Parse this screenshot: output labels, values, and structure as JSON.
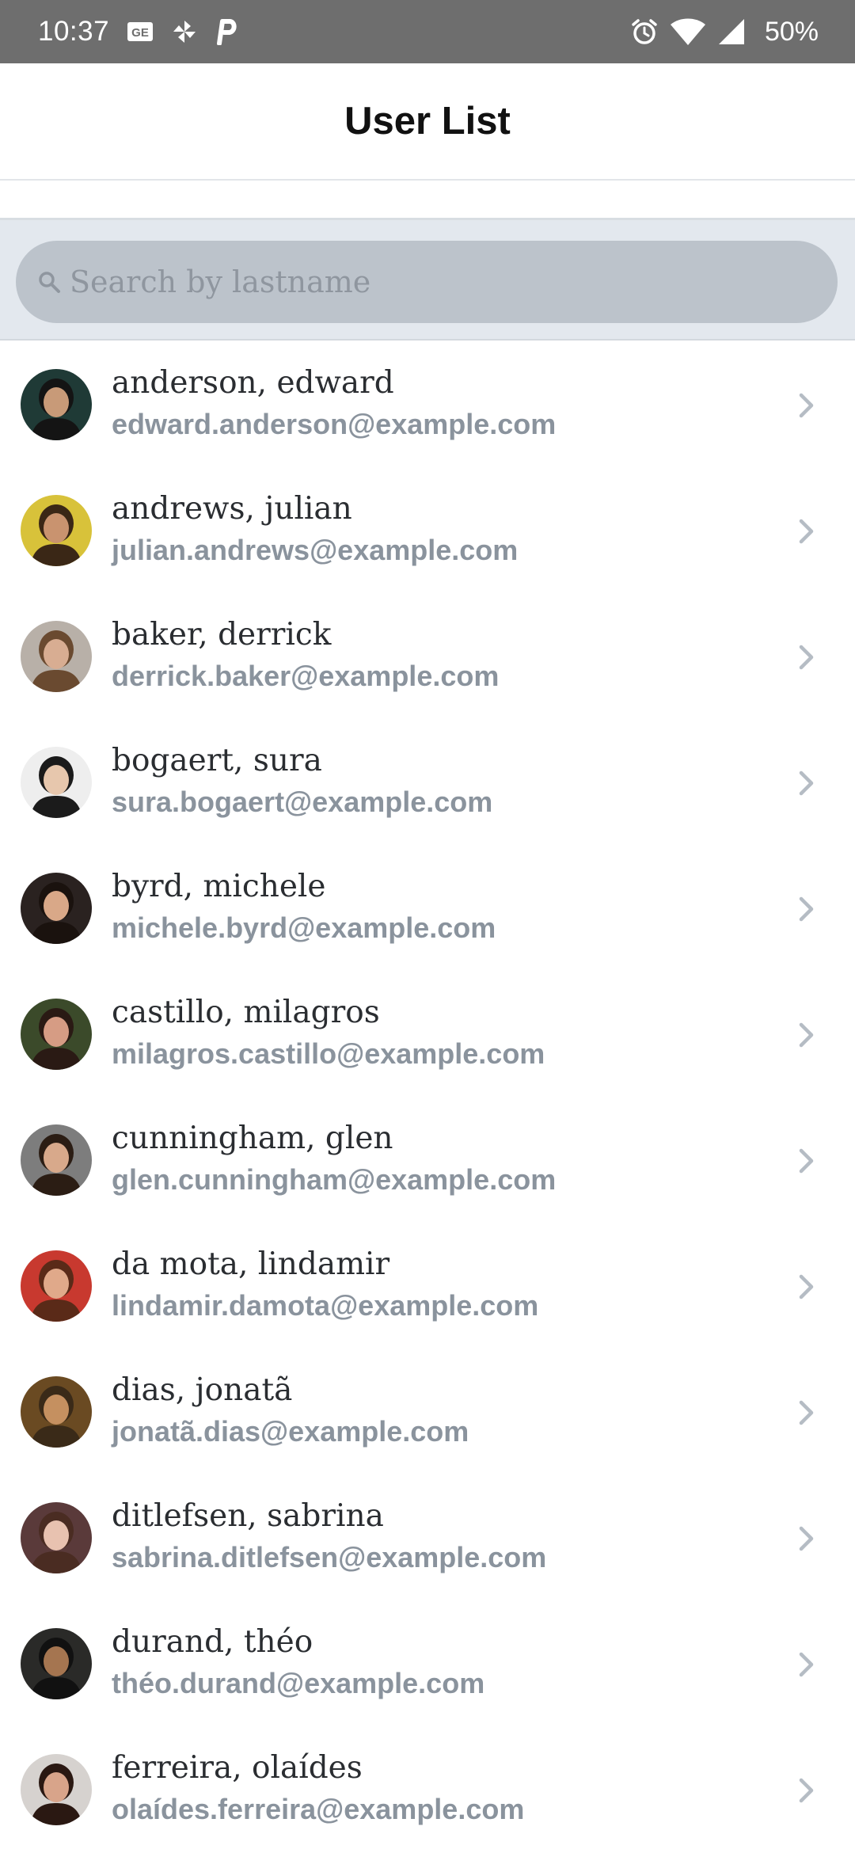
{
  "status_bar": {
    "time": "10:37",
    "battery": "50%",
    "left_icons": [
      "gmail-icon",
      "pinwheel-icon",
      "parking-icon"
    ],
    "right_icons": [
      "alarm-icon",
      "wifi-icon",
      "cell-signal-icon"
    ]
  },
  "header": {
    "title": "User List"
  },
  "search": {
    "placeholder": "Search by lastname",
    "value": ""
  },
  "users": [
    {
      "name": "anderson, edward",
      "email": "edward.anderson@example.com",
      "avatar_bg": "#1f3a36",
      "avatar_skin": "#c89a78",
      "avatar_hair": "#141414"
    },
    {
      "name": "andrews, julian",
      "email": "julian.andrews@example.com",
      "avatar_bg": "#d8c23a",
      "avatar_skin": "#c9936f",
      "avatar_hair": "#3a2716"
    },
    {
      "name": "baker, derrick",
      "email": "derrick.baker@example.com",
      "avatar_bg": "#b8b0a8",
      "avatar_skin": "#d8ad92",
      "avatar_hair": "#6a4a30"
    },
    {
      "name": "bogaert, sura",
      "email": "sura.bogaert@example.com",
      "avatar_bg": "#eeeeee",
      "avatar_skin": "#e7c7ad",
      "avatar_hair": "#1b1b1b"
    },
    {
      "name": "byrd, michele",
      "email": "michele.byrd@example.com",
      "avatar_bg": "#2a2220",
      "avatar_skin": "#d9a888",
      "avatar_hair": "#1a120e"
    },
    {
      "name": "castillo, milagros",
      "email": "milagros.castillo@example.com",
      "avatar_bg": "#3b4a2a",
      "avatar_skin": "#d69c84",
      "avatar_hair": "#2a1a14"
    },
    {
      "name": "cunningham, glen",
      "email": "glen.cunningham@example.com",
      "avatar_bg": "#7d7d7d",
      "avatar_skin": "#d8a98b",
      "avatar_hair": "#2b1d14"
    },
    {
      "name": "da mota, lindamir",
      "email": "lindamir.damota@example.com",
      "avatar_bg": "#c8392f",
      "avatar_skin": "#e0a98a",
      "avatar_hair": "#5a2a18"
    },
    {
      "name": "dias, jonatã",
      "email": "jonatã.dias@example.com",
      "avatar_bg": "#6a4a22",
      "avatar_skin": "#c59060",
      "avatar_hair": "#3a2a18"
    },
    {
      "name": "ditlefsen, sabrina",
      "email": "sabrina.ditlefsen@example.com",
      "avatar_bg": "#5a3a3a",
      "avatar_skin": "#e8c2b0",
      "avatar_hair": "#4a2c22"
    },
    {
      "name": "durand, théo",
      "email": "théo.durand@example.com",
      "avatar_bg": "#2a2a28",
      "avatar_skin": "#a57550",
      "avatar_hair": "#111111"
    },
    {
      "name": "ferreira, olaídes",
      "email": "olaídes.ferreira@example.com",
      "avatar_bg": "#d6d2cf",
      "avatar_skin": "#d8a48a",
      "avatar_hair": "#2a1812"
    }
  ],
  "colors": {
    "status_bar_bg": "#6e6e6e",
    "search_area_bg": "#e3e8ee",
    "search_pill_bg": "#bcc3cb",
    "email_text": "#8a939d",
    "name_text": "#2a2d31",
    "chevron": "#b5bcc4"
  }
}
